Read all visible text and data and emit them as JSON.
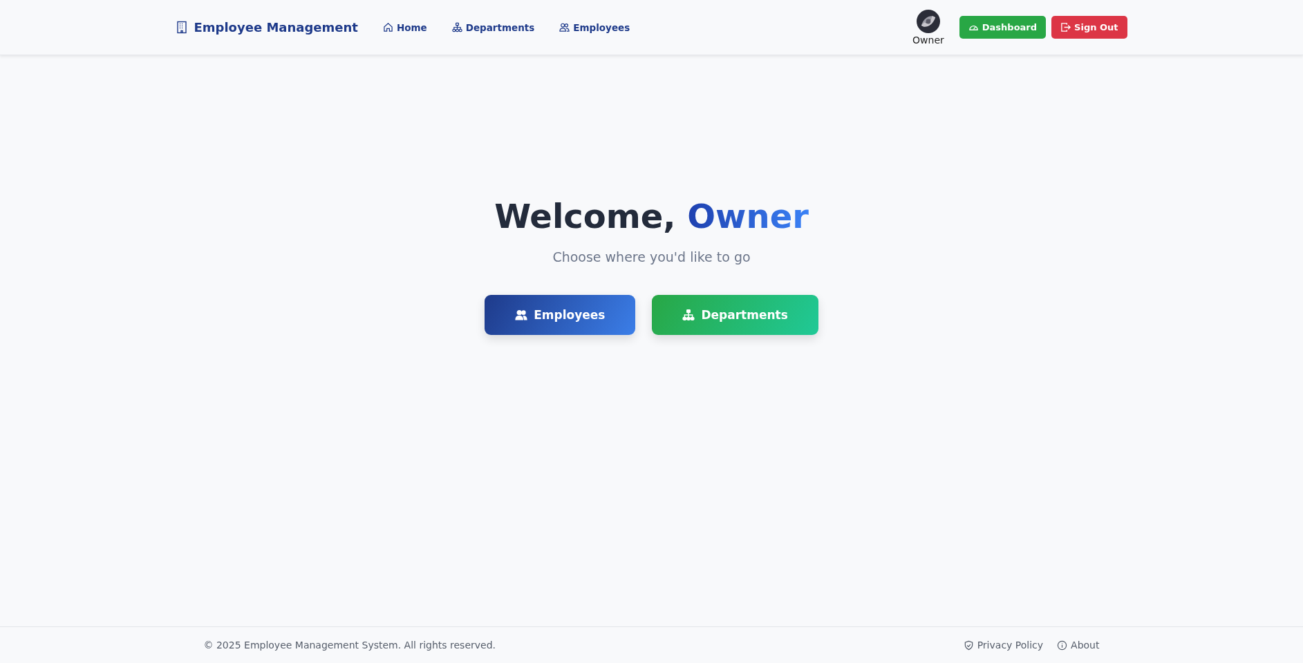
{
  "navbar": {
    "brand": "Employee Management",
    "links": [
      {
        "label": "Home"
      },
      {
        "label": "Departments"
      },
      {
        "label": "Employees"
      }
    ],
    "user": {
      "name": "Owner"
    },
    "actions": [
      {
        "label": "Dashboard",
        "kind": "success"
      },
      {
        "label": "Sign Out",
        "kind": "danger"
      }
    ]
  },
  "hero": {
    "greeting": "Welcome,",
    "name": "Owner",
    "subtitle": "Choose where you'd like to go",
    "buttons": [
      {
        "label": "Employees",
        "kind": "primary"
      },
      {
        "label": "Departments",
        "kind": "success"
      }
    ]
  },
  "footer": {
    "copyright": "© 2025 Employee Management System. All rights reserved.",
    "links": [
      {
        "label": "Privacy Policy"
      },
      {
        "label": "About"
      }
    ]
  }
}
